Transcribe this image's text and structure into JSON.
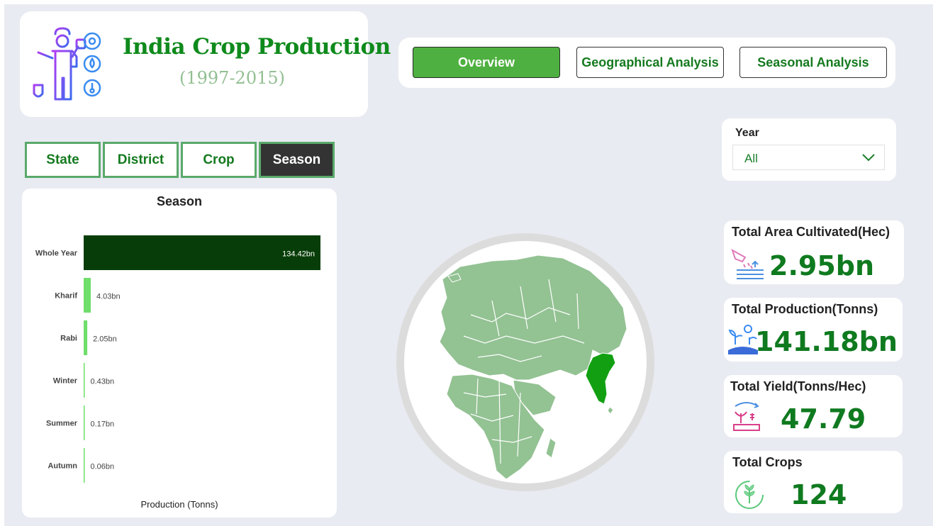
{
  "header": {
    "title": "India Crop Production",
    "subtitle": "(1997-2015)",
    "icon": "farmer-icon"
  },
  "nav": {
    "overview": "Overview",
    "geographical": "Geographical Analysis",
    "seasonal": "Seasonal Analysis",
    "active": "Overview"
  },
  "tabs": {
    "state": "State",
    "district": "District",
    "crop": "Crop",
    "season": "Season",
    "active": "Season"
  },
  "filter": {
    "label": "Year",
    "value": "All"
  },
  "kpis": {
    "area": {
      "label": "Total Area Cultivated(Hec)",
      "value": "2.95bn",
      "icon": "irrigation-icon"
    },
    "production": {
      "label": "Total Production(Tonns)",
      "value": "141.18bn",
      "icon": "plants-icon"
    },
    "yield": {
      "label": "Total Yield(Tonns/Hec)",
      "value": "47.79",
      "icon": "yield-icon"
    },
    "crops": {
      "label": "Total Crops",
      "value": "124",
      "icon": "wheat-icon"
    }
  },
  "colors": {
    "accent": "#4eb040",
    "kpi_value": "#0f7a1f",
    "bar_top": "#073d08",
    "bar": "#6fde6a",
    "map_land": "#93c293",
    "map_highlight": "#12a012"
  },
  "chart_data": {
    "type": "bar",
    "orientation": "horizontal",
    "title": "Season",
    "xlabel": "Production (Tonns)",
    "ylabel": "",
    "categories": [
      "Whole Year",
      "Kharif",
      "Rabi",
      "Winter",
      "Summer",
      "Autumn"
    ],
    "values": [
      134.42,
      4.03,
      2.05,
      0.43,
      0.17,
      0.06
    ],
    "value_labels": [
      "134.42bn",
      "4.03bn",
      "2.05bn",
      "0.43bn",
      "0.17bn",
      "0.06bn"
    ],
    "unit": "bn",
    "grid": false
  }
}
